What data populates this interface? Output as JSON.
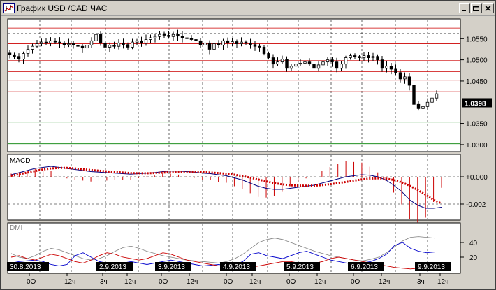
{
  "window": {
    "title": "График USD /CAD  ЧАС",
    "buttons": {
      "minimize": "minimize",
      "maximize": "maximize",
      "close": "close"
    }
  },
  "colors": {
    "resistance": "#cc0000",
    "support": "#008000",
    "signal": "#cc0000",
    "dmi_plus": "#0000cc",
    "dmi_minus": "#cc0000",
    "adx": "#808080"
  },
  "price_panel": {
    "y_ticks": [
      "1.0550",
      "1.0500",
      "1.0450",
      "1.0350",
      "1.0300"
    ],
    "current_price": "1.0398",
    "resistance_levels": [
      1.0575,
      1.0538,
      1.0498,
      1.0472,
      1.0452,
      1.0425
    ],
    "support_levels": [
      1.0375,
      1.0353,
      1.0302
    ],
    "dashed_levels": [
      1.0562,
      1.0398
    ]
  },
  "macd_panel": {
    "label": "MACD",
    "y_ticks": [
      "+0.000",
      "-0.002"
    ]
  },
  "dmi_panel": {
    "label": "DMI",
    "y_ticks": [
      "40",
      "20"
    ]
  },
  "dates": [
    "30.8.2013",
    "2.9.2013",
    "3.9.2013",
    "4.9.2013",
    "5.9.2013",
    "6.9.2013",
    "9.9.2013"
  ],
  "time_labels": [
    "0О",
    "12ч",
    "3ч",
    "12ч",
    "0О",
    "12ч",
    "0О",
    "12ч",
    "0О",
    "12ч",
    "0О",
    "12ч",
    "3ч",
    "12ч"
  ],
  "chart_data": {
    "type": "candlestick",
    "y_range": [
      1.0285,
      1.0595
    ],
    "close_path": [
      1.0512,
      1.0508,
      1.0502,
      1.0515,
      1.0525,
      1.0532,
      1.0538,
      1.0542,
      1.054,
      1.0545,
      1.0542,
      1.054,
      1.0536,
      1.0538,
      1.0535,
      1.0532,
      1.0528,
      1.0535,
      1.0545,
      1.056,
      1.054,
      1.053,
      1.0535,
      1.0532,
      1.054,
      1.0536,
      1.053,
      1.0542,
      1.0545,
      1.054,
      1.0548,
      1.0552,
      1.0555,
      1.056,
      1.0558,
      1.0555,
      1.056,
      1.0556,
      1.0552,
      1.055,
      1.0548,
      1.0545,
      1.0535,
      1.054,
      1.0525,
      1.0538,
      1.0535,
      1.0545,
      1.054,
      1.0543,
      1.0538,
      1.0542,
      1.054,
      1.0536,
      1.0532,
      1.053,
      1.0515,
      1.0505,
      1.049,
      1.0495,
      1.0502,
      1.048,
      1.0485,
      1.049,
      1.0492,
      1.0495,
      1.049,
      1.048,
      1.0488,
      1.0495,
      1.05,
      1.0495,
      1.048,
      1.049,
      1.0505,
      1.051,
      1.0508,
      1.0505,
      1.051,
      1.0505,
      1.0508,
      1.05,
      1.048,
      1.0485,
      1.0478,
      1.047,
      1.0455,
      1.046,
      1.044,
      1.0395,
      1.0385,
      1.039,
      1.04,
      1.041,
      1.042,
      1.0412,
      1.0405,
      1.04,
      1.0398
    ]
  }
}
